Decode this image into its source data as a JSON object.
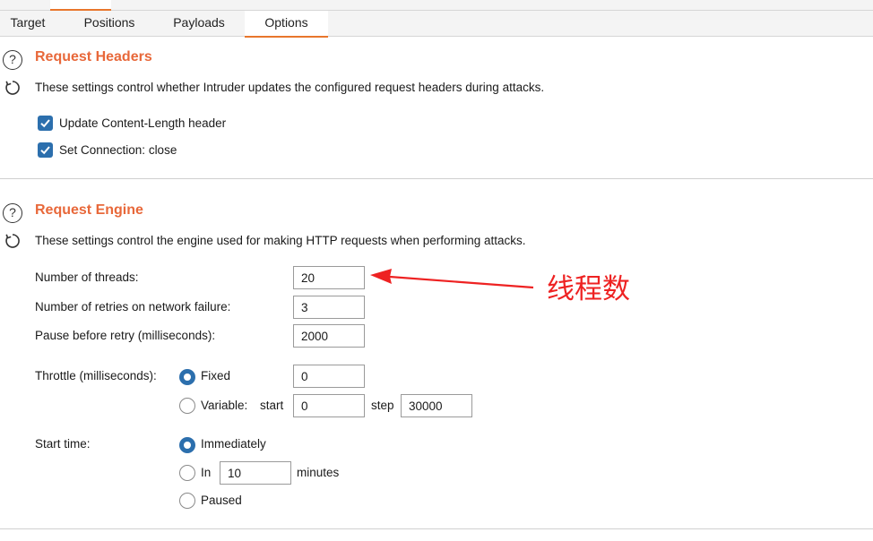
{
  "top_tabs": [
    {
      "label": "Target",
      "active": false
    },
    {
      "label": "Positions",
      "active": false
    },
    {
      "label": "Payloads",
      "active": false
    },
    {
      "label": "Options",
      "active": true
    }
  ],
  "request_headers": {
    "title": "Request Headers",
    "description": "These settings control whether Intruder updates the configured request headers during attacks.",
    "options": [
      {
        "label": "Update Content-Length header",
        "checked": true
      },
      {
        "label": "Set Connection: close",
        "checked": true
      }
    ]
  },
  "request_engine": {
    "title": "Request Engine",
    "description": "These settings control the engine used for making HTTP requests when performing attacks.",
    "threads_label": "Number of threads:",
    "threads_value": "20",
    "retries_label": "Number of retries on network failure:",
    "retries_value": "3",
    "pause_label": "Pause before retry (milliseconds):",
    "pause_value": "2000",
    "throttle_label": "Throttle (milliseconds):",
    "throttle_fixed_label": "Fixed",
    "throttle_fixed_value": "0",
    "throttle_variable_label": "Variable:",
    "throttle_start_label": "start",
    "throttle_start_value": "0",
    "throttle_step_label": "step",
    "throttle_step_value": "30000",
    "throttle_selected": "fixed",
    "start_time_label": "Start time:",
    "start_immediately_label": "Immediately",
    "start_in_label": "In",
    "start_in_value": "10",
    "start_minutes_label": "minutes",
    "start_paused_label": "Paused",
    "start_selected": "immediately"
  },
  "annotation": {
    "text": "线程数",
    "color": "#ee2222"
  },
  "colors": {
    "accent_orange": "#e8683a",
    "checkbox_blue": "#2c6fad"
  }
}
